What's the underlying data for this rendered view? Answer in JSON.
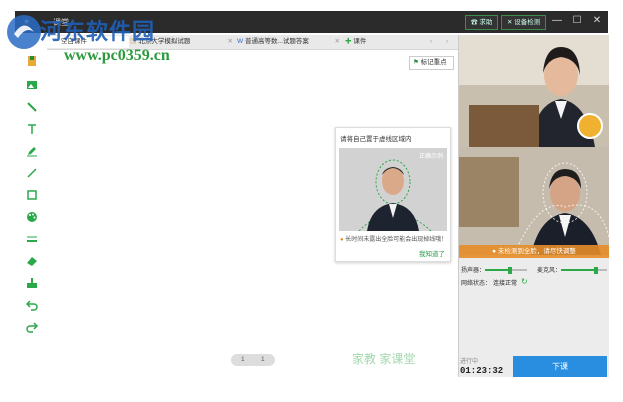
{
  "window": {
    "title": "课堂",
    "help_label": "求助",
    "device_check_label": "设备检测"
  },
  "tabs": [
    {
      "label": "空白课件"
    },
    {
      "label": "北京大学模拟试题"
    },
    {
      "label": "普通高等数...试题答案"
    },
    {
      "label": "课件"
    }
  ],
  "canvas": {
    "mark_label": "标记重点"
  },
  "popup": {
    "title": "请将自己置于虚线区域内",
    "preview_badge": "正确示例",
    "warning": "长时间未露出全脸可能会出现掉线哦！",
    "confirm_link": "我知道了"
  },
  "pager": {
    "current": "1",
    "total": "1"
  },
  "side_panel": {
    "camera_warning": "未检测到全脸，请尽快调整",
    "speaker_label": "扬声器：",
    "mic_label": "麦克风：",
    "speaker_level": 0.6,
    "mic_level": 0.75,
    "network_label": "网络状态：",
    "network_status": "连接正常"
  },
  "class_timer": {
    "label": "进行中",
    "time": "01:23:32"
  },
  "end_button_label": "下课",
  "brand": {
    "text": "家教 家课堂"
  },
  "watermark": {
    "title": "河东软件园",
    "url": "www.pc0359.cn"
  },
  "colors": {
    "accent_green": "#2aa84a",
    "end_button_blue": "#2a8ee0",
    "titlebar": "#2b2b2b"
  }
}
